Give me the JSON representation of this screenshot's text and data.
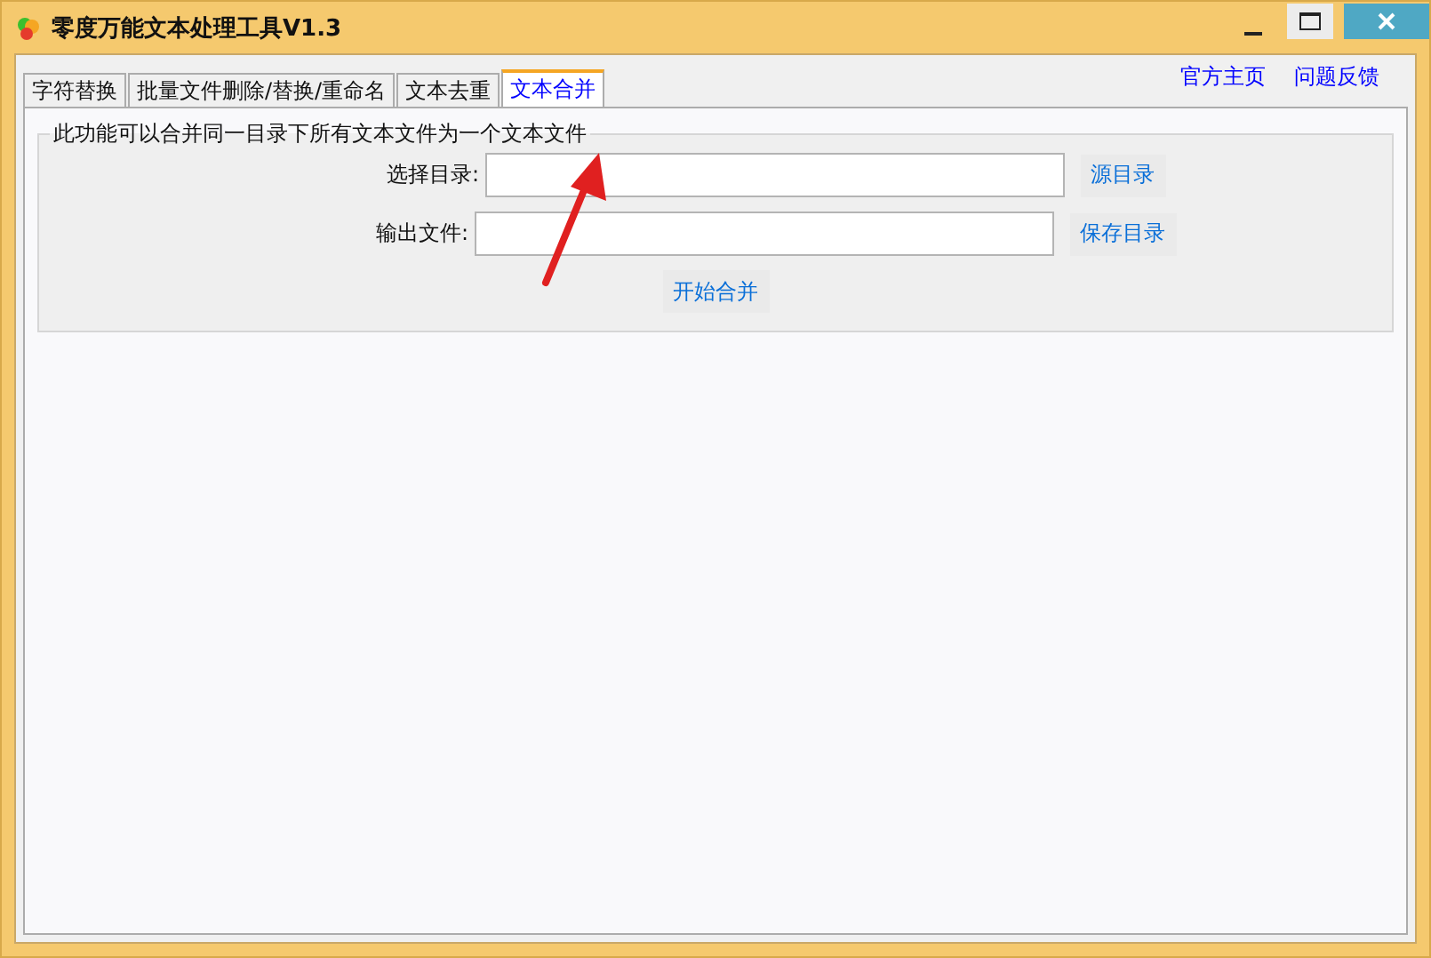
{
  "window": {
    "title": "零度万能文本处理工具V1.3"
  },
  "tabs": [
    {
      "label": "字符替换",
      "selected": false
    },
    {
      "label": "批量文件删除/替换/重命名",
      "selected": false
    },
    {
      "label": "文本去重",
      "selected": false
    },
    {
      "label": "文本合并",
      "selected": true
    }
  ],
  "links": [
    "官方主页",
    "问题反馈"
  ],
  "group": {
    "title": "此功能可以合并同一目录下所有文本文件为一个文本文件",
    "rows": [
      {
        "label": "选择目录:",
        "button": "源目录"
      },
      {
        "label": "输出文件:",
        "button": "保存目录"
      }
    ],
    "action": "开始合并"
  }
}
